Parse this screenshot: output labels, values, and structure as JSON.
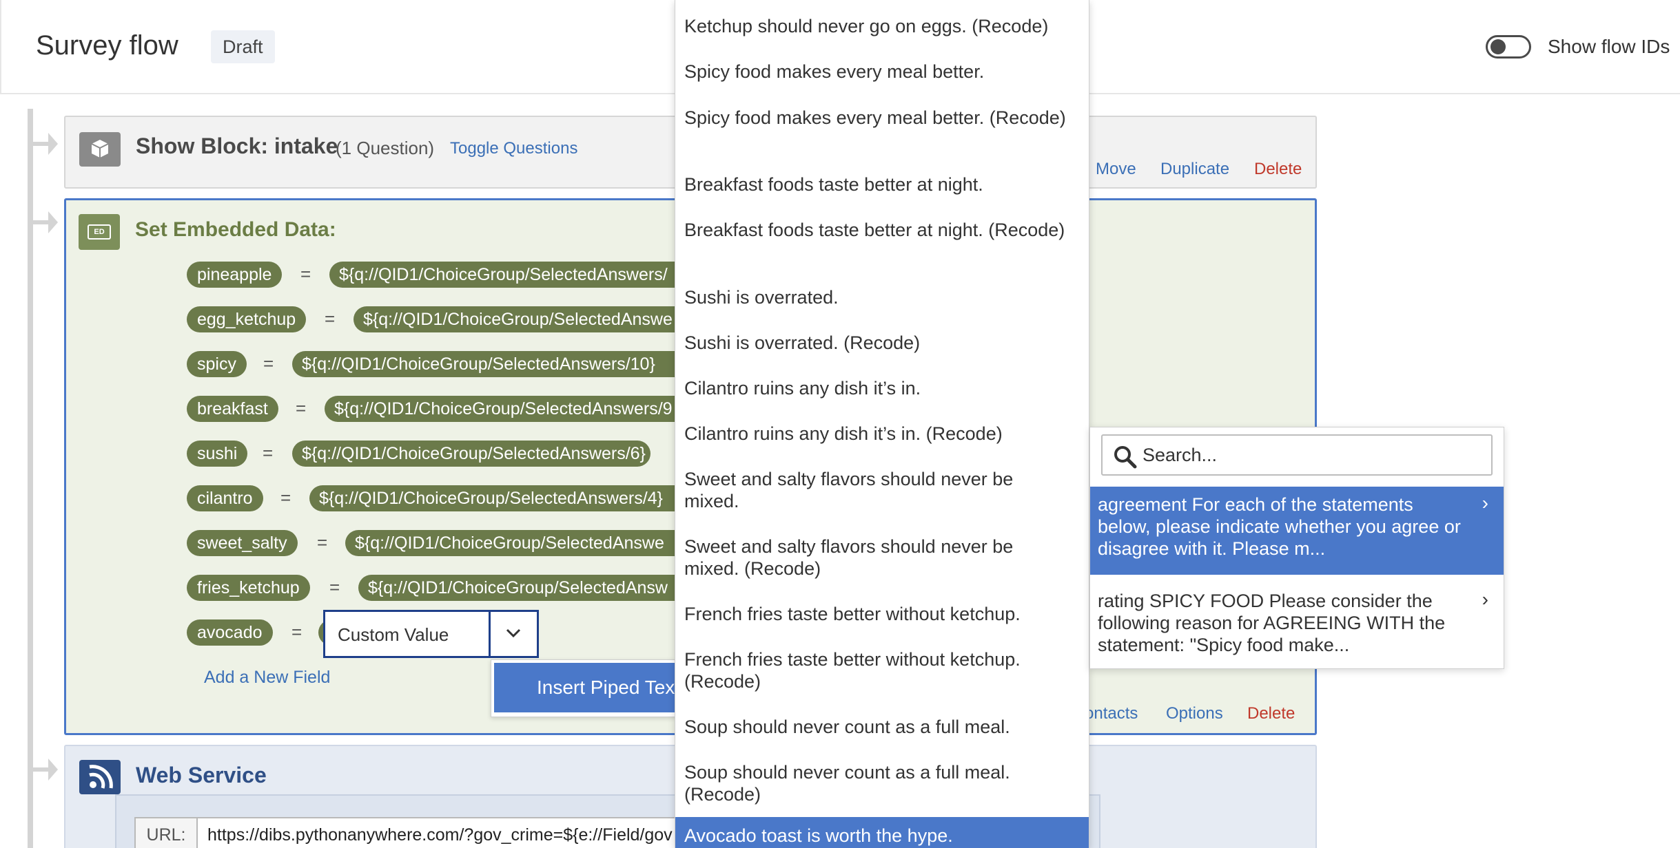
{
  "header": {
    "title": "Survey flow",
    "badge": "Draft",
    "toggle_label": "Show flow IDs"
  },
  "show_block": {
    "title": "Show Block: intake",
    "count": "(1 Question)",
    "toggle_link": "Toggle Questions",
    "actions": {
      "move": "Move",
      "duplicate": "Duplicate",
      "delete": "Delete"
    }
  },
  "embedded": {
    "title": "Set Embedded Data:",
    "icon_label": "ED",
    "fields": [
      {
        "name": "pineapple",
        "value": "${q://QID1/ChoiceGroup/SelectedAnswers/"
      },
      {
        "name": "egg_ketchup",
        "value": "${q://QID1/ChoiceGroup/SelectedAnswe"
      },
      {
        "name": "spicy",
        "value": "${q://QID1/ChoiceGroup/SelectedAnswers/10}"
      },
      {
        "name": "breakfast",
        "value": "${q://QID1/ChoiceGroup/SelectedAnswers/9"
      },
      {
        "name": "sushi",
        "value": "${q://QID1/ChoiceGroup/SelectedAnswers/6}"
      },
      {
        "name": "cilantro",
        "value": "${q://QID1/ChoiceGroup/SelectedAnswers/4}"
      },
      {
        "name": "sweet_salty",
        "value": "${q://QID1/ChoiceGroup/SelectedAnswe"
      },
      {
        "name": "fries_ketchup",
        "value": "${q://QID1/ChoiceGroup/SelectedAnsw"
      },
      {
        "name": "avocado",
        "value": ""
      }
    ],
    "equals": "=",
    "custom_value": "Custom Value",
    "insert_piped": "Insert Piped Text",
    "add_field": "Add a New Field",
    "bottom_actions": {
      "contacts": "ontacts",
      "options": "Options",
      "delete": "Delete"
    }
  },
  "web_service": {
    "title": "Web Service",
    "url_label": "URL:",
    "url_value": "https://dibs.pythonanywhere.com/?gov_crime=${e://Field/gov"
  },
  "statements": [
    "Ketchup should never go on eggs. (Recode)",
    "Spicy food makes every meal better.",
    "Spicy food makes every meal better. (Recode)",
    "Breakfast foods taste better at night.",
    "Breakfast foods taste better at night. (Recode)",
    "Sushi is overrated.",
    "Sushi is overrated. (Recode)",
    "Cilantro ruins any dish it’s in.",
    "Cilantro ruins any dish it’s in. (Recode)",
    "Sweet and salty flavors should never be mixed.",
    "Sweet and salty flavors should never be mixed. (Recode)",
    "French fries taste better without ketchup.",
    "French fries taste better without ketchup. (Recode)",
    "Soup should never count as a full meal.",
    "Soup should never count as a full meal. (Recode)"
  ],
  "statement_active": "Avocado toast is worth the hype.",
  "pipe_menu": {
    "search_placeholder": "Search...",
    "items": [
      "agreement For each of the statements below, please indicate whether you agree or disagree with it. Please m...",
      "rating SPICY FOOD Please consider the following reason for AGREEING WITH the statement: \"Spicy food make..."
    ],
    "chevron": "›"
  },
  "colors": {
    "accent": "#4a78c9",
    "ed_green": "#6b7a4a",
    "delete_red": "#c0392b",
    "link_blue": "#3b6fb6"
  }
}
